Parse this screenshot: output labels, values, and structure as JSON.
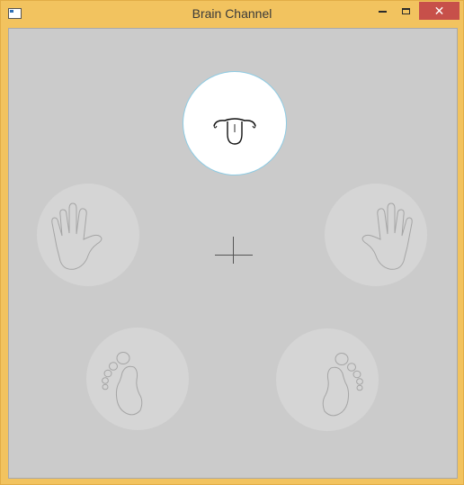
{
  "window": {
    "title": "Brain Channel",
    "controls": {
      "minimize_icon": "minimize-icon",
      "maximize_icon": "maximize-icon",
      "close_glyph": "✕"
    },
    "colors": {
      "frame": "#f2c35f",
      "close_button": "#c7504a",
      "canvas": "#cbcbcb",
      "cue_inactive": "#d5d5d5",
      "cue_active": "#ffffff"
    }
  },
  "canvas": {
    "cues": [
      {
        "name": "tongue",
        "icon": "tongue-icon",
        "active": true
      },
      {
        "name": "left-hand",
        "icon": "left-hand-icon",
        "active": false
      },
      {
        "name": "right-hand",
        "icon": "right-hand-icon",
        "active": false
      },
      {
        "name": "left-foot",
        "icon": "left-foot-icon",
        "active": false
      },
      {
        "name": "right-foot",
        "icon": "right-foot-icon",
        "active": false
      }
    ],
    "fixation": "fixation-cross"
  }
}
